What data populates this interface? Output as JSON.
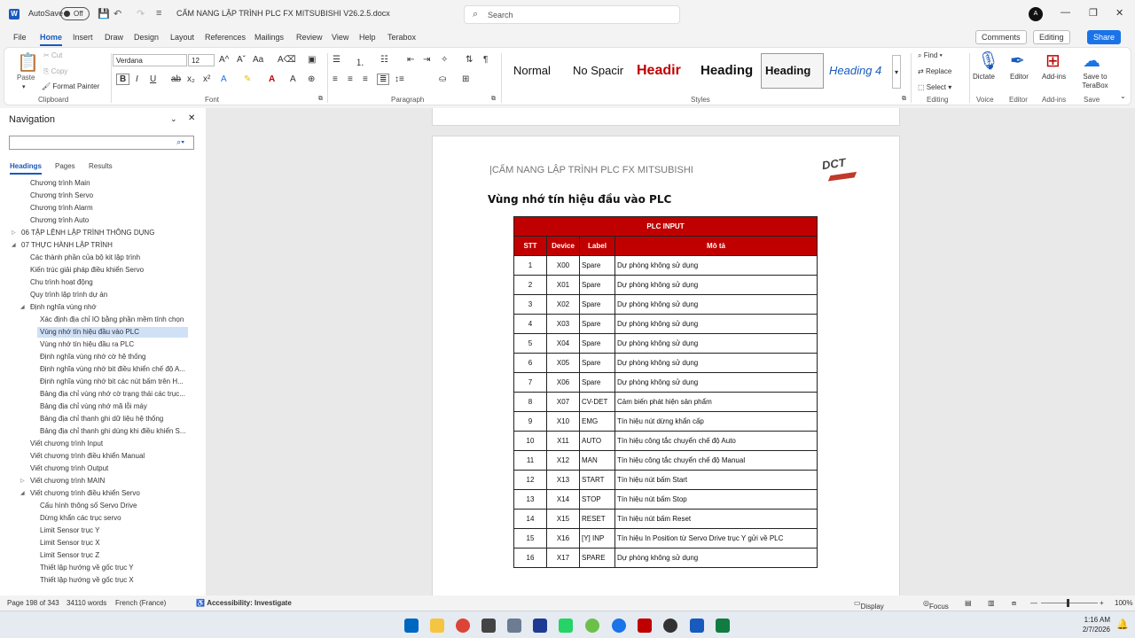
{
  "titlebar": {
    "autosave": "AutoSave",
    "toggle": "Off",
    "doc_title": "CẨM NANG LẬP TRÌNH PLC FX MITSUBISHI V26.2.5.docx",
    "search_placeholder": "Search"
  },
  "menu": {
    "items": [
      "File",
      "Home",
      "Insert",
      "Draw",
      "Design",
      "Layout",
      "References",
      "Mailings",
      "Review",
      "View",
      "Help",
      "Terabox"
    ],
    "comments": "Comments",
    "editing": "Editing",
    "share": "Share"
  },
  "ribbon": {
    "paste": "Paste",
    "cut": "Cut",
    "copy": "Copy",
    "format_painter": "Format Painter",
    "clipboard": "Clipboard",
    "font_name": "Verdana",
    "font_size": "12",
    "font": "Font",
    "paragraph": "Paragraph",
    "styles": [
      "Normal",
      "No Spacir",
      "Headir",
      "Heading",
      "Heading",
      "Heading 4"
    ],
    "styles_label": "Styles",
    "find": "Find",
    "replace": "Replace",
    "select": "Select",
    "editing_label": "Editing",
    "dictate": "Dictate",
    "voice": "Voice",
    "editor": "Editor",
    "editor_label": "Editor",
    "addins": "Add-ins",
    "addins_label": "Add-ins",
    "save_terabox": "Save to TeraBox",
    "save_label": "Save"
  },
  "nav": {
    "title": "Navigation",
    "tabs": [
      "Headings",
      "Pages",
      "Results"
    ],
    "items": [
      {
        "text": "Chương trình Main",
        "level": 2
      },
      {
        "text": "Chương trình Servo",
        "level": 2
      },
      {
        "text": "Chương trình Alarm",
        "level": 2
      },
      {
        "text": "Chương trình Auto",
        "level": 2
      },
      {
        "text": "06 TẬP LỆNH LẬP TRÌNH THÔNG DỤNG",
        "level": 1,
        "tri": "right"
      },
      {
        "text": "07 THỰC HÀNH LẬP TRÌNH",
        "level": 1,
        "tri": "down"
      },
      {
        "text": "Các thành phần của bộ kit lập trình",
        "level": 2
      },
      {
        "text": "Kiến trúc giải pháp điều khiển Servo",
        "level": 2
      },
      {
        "text": "Chu trình hoạt động",
        "level": 2
      },
      {
        "text": "Quy trình lập trình dự án",
        "level": 2
      },
      {
        "text": "Định nghĩa vùng nhớ",
        "level": 2,
        "tri": "down"
      },
      {
        "text": "Xác định địa chỉ IO bằng phần mềm tính chọn",
        "level": 3
      },
      {
        "text": "Vùng nhớ tín hiệu đầu vào PLC",
        "level": 3,
        "sel": true
      },
      {
        "text": "Vùng nhớ tín hiệu đầu ra PLC",
        "level": 3
      },
      {
        "text": "Định nghĩa vùng nhớ cờ hệ thống",
        "level": 3
      },
      {
        "text": "Định nghĩa vùng nhớ bit điều khiển chế độ A...",
        "level": 3
      },
      {
        "text": "Định nghĩa vùng nhớ bit các nút bấm trên H...",
        "level": 3
      },
      {
        "text": "Bảng địa chỉ vùng nhớ cờ trạng thái các trục...",
        "level": 3
      },
      {
        "text": "Bảng địa chỉ vùng nhớ mã lỗi máy",
        "level": 3
      },
      {
        "text": "Bảng địa chỉ thanh ghi dữ liệu hệ thống",
        "level": 3
      },
      {
        "text": "Bảng địa chỉ thanh ghi dùng khi điều khiển S...",
        "level": 3
      },
      {
        "text": "Viết chương trình Input",
        "level": 2
      },
      {
        "text": "Viết chương trình điều khiển Manual",
        "level": 2
      },
      {
        "text": "Viết chương trình Output",
        "level": 2
      },
      {
        "text": "Viết chương trình MAIN",
        "level": 2,
        "tri": "right"
      },
      {
        "text": "Viết chương trình điều khiển Servo",
        "level": 2,
        "tri": "down"
      },
      {
        "text": "Cấu hình thông số Servo Drive",
        "level": 3
      },
      {
        "text": "Dừng khẩn các trục servo",
        "level": 3
      },
      {
        "text": "Limit Sensor trục Y",
        "level": 3
      },
      {
        "text": "Limit Sensor trục X",
        "level": 3
      },
      {
        "text": "Limit Sensor trục Z",
        "level": 3
      },
      {
        "text": "Thiết lập hướng về gốc trục Y",
        "level": 3
      },
      {
        "text": "Thiết lập hướng về gốc trục X",
        "level": 3
      }
    ]
  },
  "doc": {
    "header": "|CẨM NANG LẬP TRÌNH PLC FX MITSUBISHI",
    "logo": "DCT",
    "heading": "Vùng nhớ tín hiệu đầu vào PLC",
    "table_title": "PLC INPUT",
    "columns": [
      "STT",
      "Device",
      "Label",
      "Mô tả"
    ],
    "rows": [
      [
        "1",
        "X00",
        "Spare",
        "Dự phòng không sử dụng"
      ],
      [
        "2",
        "X01",
        "Spare",
        "Dự phòng không sử dụng"
      ],
      [
        "3",
        "X02",
        "Spare",
        "Dự phòng không sử dụng"
      ],
      [
        "4",
        "X03",
        "Spare",
        "Dự phòng không sử dụng"
      ],
      [
        "5",
        "X04",
        "Spare",
        "Dự phòng không sử dụng"
      ],
      [
        "6",
        "X05",
        "Spare",
        "Dự phòng không sử dụng"
      ],
      [
        "7",
        "X06",
        "Spare",
        "Dự phòng không sử dụng"
      ],
      [
        "8",
        "X07",
        "CV-DET",
        "Cảm biến phát hiện sản phẩm"
      ],
      [
        "9",
        "X10",
        "EMG",
        "Tín hiệu nút dừng khẩn cấp"
      ],
      [
        "10",
        "X11",
        "AUTO",
        "Tín hiệu công tắc chuyển chế độ Auto"
      ],
      [
        "11",
        "X12",
        "MAN",
        "Tín hiệu công tắc chuyển chế độ Manual"
      ],
      [
        "12",
        "X13",
        "START",
        "Tín hiệu nút bấm Start"
      ],
      [
        "13",
        "X14",
        "STOP",
        "Tín hiệu nút bấm Stop"
      ],
      [
        "14",
        "X15",
        "RESET",
        "Tín hiệu nút bấm Reset"
      ],
      [
        "15",
        "X16",
        "[Y] INP",
        "Tín hiệu In Position từ Servo Drive trục Y gửi về PLC"
      ],
      [
        "16",
        "X17",
        "SPARE",
        "Dự phòng không sử dụng"
      ]
    ]
  },
  "status": {
    "page": "Page 198 of 343",
    "words": "34110 words",
    "language": "French (France)",
    "accessibility": "Accessibility: Investigate",
    "display_settings": "Display Settings",
    "focus": "Focus",
    "zoom": "100%"
  },
  "clock": {
    "time": "1:16 AM",
    "date": "2/7/2026"
  }
}
